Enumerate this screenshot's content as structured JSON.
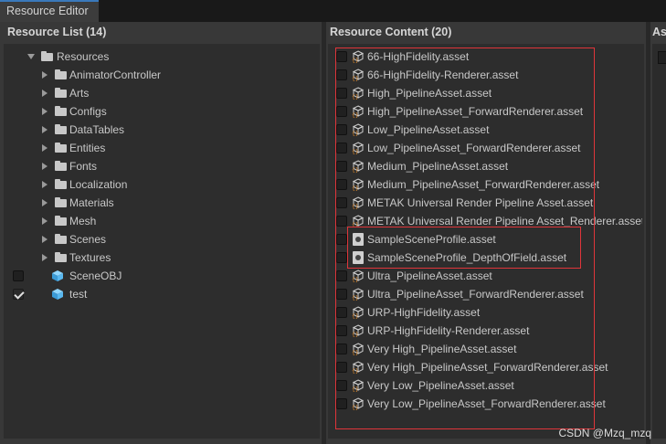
{
  "window": {
    "tab_title": "Resource Editor"
  },
  "resource_list": {
    "header": "Resource List (14)",
    "root": "Resources",
    "folders": [
      "AnimatorController",
      "Arts",
      "Configs",
      "DataTables",
      "Entities",
      "Fonts",
      "Localization",
      "Materials",
      "Mesh",
      "Scenes",
      "Textures"
    ],
    "objects": [
      {
        "label": "SceneOBJ",
        "checked": false
      },
      {
        "label": "test",
        "checked": true
      }
    ]
  },
  "resource_content": {
    "header": "Resource Content (20)",
    "items": [
      {
        "label": "66-HighFidelity.asset",
        "icon": "asset-icon"
      },
      {
        "label": "66-HighFidelity-Renderer.asset",
        "icon": "asset-icon"
      },
      {
        "label": "High_PipelineAsset.asset",
        "icon": "asset-icon"
      },
      {
        "label": "High_PipelineAsset_ForwardRenderer.asset",
        "icon": "asset-icon"
      },
      {
        "label": "Low_PipelineAsset.asset",
        "icon": "asset-icon"
      },
      {
        "label": "Low_PipelineAsset_ForwardRenderer.asset",
        "icon": "asset-icon"
      },
      {
        "label": "Medium_PipelineAsset.asset",
        "icon": "asset-icon"
      },
      {
        "label": "Medium_PipelineAsset_ForwardRenderer.asset",
        "icon": "asset-icon"
      },
      {
        "label": "METAK Universal Render Pipeline Asset.asset",
        "icon": "asset-icon"
      },
      {
        "label": "METAK Universal Render Pipeline Asset_Renderer.asset",
        "icon": "asset-icon"
      },
      {
        "label": "SampleSceneProfile.asset",
        "icon": "profile-icon"
      },
      {
        "label": "SampleSceneProfile_DepthOfField.asset",
        "icon": "profile-icon"
      },
      {
        "label": "Ultra_PipelineAsset.asset",
        "icon": "asset-icon"
      },
      {
        "label": "Ultra_PipelineAsset_ForwardRenderer.asset",
        "icon": "asset-icon"
      },
      {
        "label": "URP-HighFidelity.asset",
        "icon": "asset-icon"
      },
      {
        "label": "URP-HighFidelity-Renderer.asset",
        "icon": "asset-icon"
      },
      {
        "label": "Very High_PipelineAsset.asset",
        "icon": "asset-icon"
      },
      {
        "label": "Very High_PipelineAsset_ForwardRenderer.asset",
        "icon": "asset-icon"
      },
      {
        "label": "Very Low_PipelineAsset.asset",
        "icon": "asset-icon"
      },
      {
        "label": "Very Low_PipelineAsset_ForwardRenderer.asset",
        "icon": "asset-icon"
      }
    ]
  },
  "third_panel": {
    "header_partial": "As"
  },
  "watermark": "CSDN @Mzq_mzq",
  "colors": {
    "accent": "#3a79bb",
    "highlight_box": "#e0353a",
    "cube_blue": "#59b8f0"
  }
}
